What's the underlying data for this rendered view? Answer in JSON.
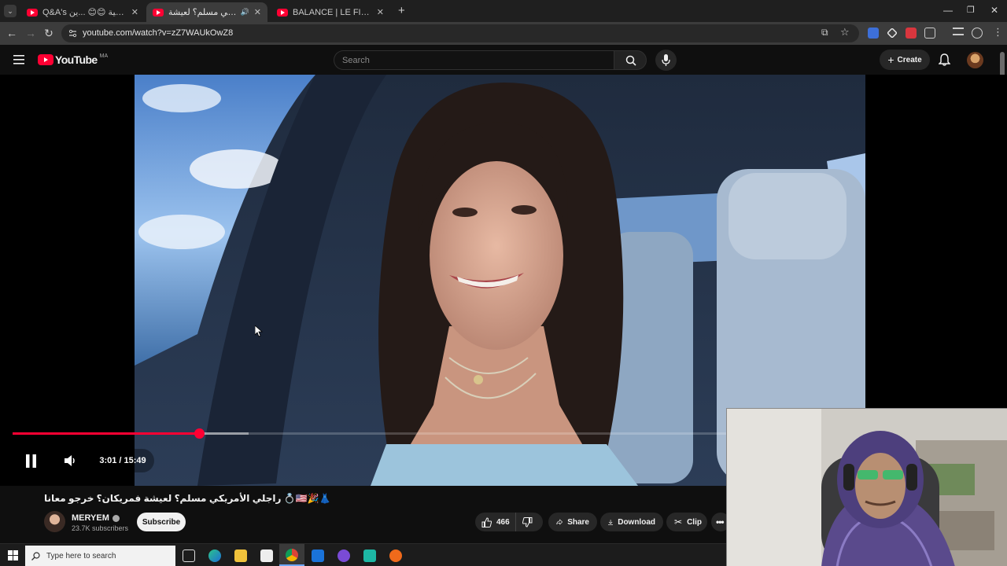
{
  "browser": {
    "tabs": [
      {
        "label": "Q&A's إ[العلاقة الصحية 😊😊 ...ين",
        "active": false
      },
      {
        "label": "راجلي الأمريكي مسلم؟ لعيشة...",
        "active": true
      },
      {
        "label": "BALANCE | LE FILM | MON TOU",
        "active": false
      }
    ],
    "new_tab_label": "+",
    "url": "youtube.com/watch?v=zZ7WAUkOwZ8"
  },
  "youtube": {
    "logo_text": "YouTube",
    "region": "MA",
    "search_placeholder": "Search",
    "create_label": "Create"
  },
  "player": {
    "time_current": "3:01",
    "time_separator": "/",
    "time_total": "15:49",
    "played_fraction": 0.19,
    "buffered_fraction": 0.24
  },
  "video": {
    "title": "راجلي الأمريكي مسلم؟ لعيشة فمريكان؟ خرجو معانا 💍🇺🇸🎉👗",
    "channel_name": "MERYEM",
    "subscribers": "23.7K subscribers",
    "subscribe_label": "Subscribe",
    "likes": "466",
    "share_label": "Share",
    "download_label": "Download",
    "clip_label": "Clip"
  },
  "taskbar": {
    "search_placeholder": "Type here to search"
  },
  "colors": {
    "yt_red": "#ff0033",
    "progress_red": "#f03",
    "background": "#0f0f0f"
  }
}
